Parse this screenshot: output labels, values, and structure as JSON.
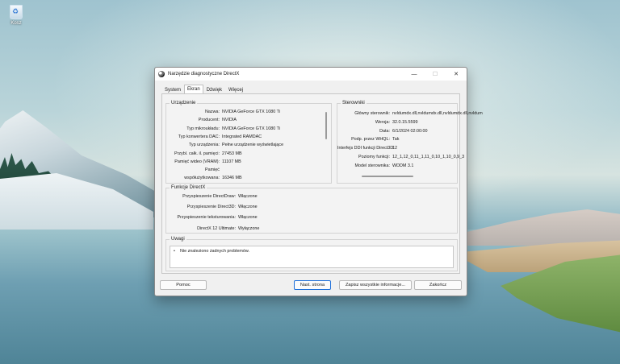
{
  "desktop": {
    "recycle_label": "Kosz"
  },
  "window": {
    "title": "Narzędzie diagnostyczne DirectX",
    "controls": {
      "minimize": "—",
      "maximize": "☐",
      "close": "✕"
    },
    "tabs": [
      "System",
      "Ekran",
      "Dźwięk",
      "Więcej"
    ],
    "active_tab": "Ekran"
  },
  "device": {
    "title": "Urządzenie",
    "rows": [
      {
        "k": "Nazwa:",
        "v": "NVIDIA GeForce GTX 1080 Ti"
      },
      {
        "k": "Producent:",
        "v": "NVIDIA"
      },
      {
        "k": "Typ mikroukładu:",
        "v": "NVIDIA GeForce GTX 1080 Ti"
      },
      {
        "k": "Typ konwertera DAC:",
        "v": "Integrated RAMDAC"
      },
      {
        "k": "Typ urządzenia:",
        "v": "Pełne urządzenie wyświetlające"
      },
      {
        "k": "Przybl. całk. il. pamięci:",
        "v": "27453 MB"
      },
      {
        "k": "Pamięć wideo (VRAM):",
        "v": "11107 MB"
      },
      {
        "k": "Pamięć",
        "v": ""
      },
      {
        "k": "współużytkowana:",
        "v": "16346 MB"
      }
    ]
  },
  "drivers": {
    "title": "Sterowniki",
    "rows": [
      {
        "k": "Główny sterownik:",
        "v": "nvldumdx.dll,nvldumdx.dll,nvldumdx.dll,nvldum"
      },
      {
        "k": "Wersja:",
        "v": "32.0.15.5599"
      },
      {
        "k": "Data:",
        "v": "6/1/2024 02:00:00"
      },
      {
        "k": "Podp. przez WHQL:",
        "v": "Tak"
      },
      {
        "k": "Interfejs DDI funkcji Direct3D:",
        "v": "12"
      },
      {
        "k": "Poziomy funkcji:",
        "v": "12_1,12_0,11_1,11_0,10_1,10_0,9_3"
      },
      {
        "k": "Model sterownika:",
        "v": "WDDM 3.1"
      }
    ]
  },
  "features": {
    "title": "Funkcje DirectX",
    "rows": [
      {
        "k": "Przyspieszenie DirectDraw:",
        "v": "Włączone"
      },
      {
        "k": "Przyspieszenie Direct3D:",
        "v": "Włączone"
      },
      {
        "k": "Przyspieszenie teksturowania:",
        "v": "Włączone"
      },
      {
        "k": "DirectX 12 Ultimate:",
        "v": "Wyłączone"
      }
    ]
  },
  "notes": {
    "title": "Uwagi",
    "bullet": "•",
    "items": [
      "Nie znaleziono żadnych problemów."
    ]
  },
  "buttons": {
    "help": "Pomoc",
    "next": "Nast. strona",
    "save": "Zapisz wszystkie informacje...",
    "exit": "Zakończ"
  }
}
